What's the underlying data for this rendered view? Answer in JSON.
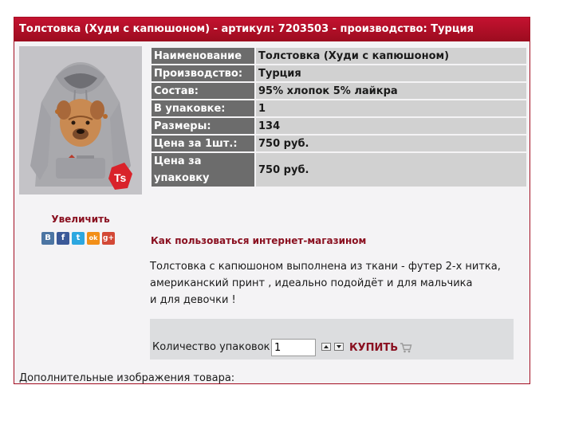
{
  "header": {
    "title": "Толстовка (Худи с капюшоном) - артикул: 7203503 - производство: Турция"
  },
  "product": {
    "image_alt": "Толстовка с принтом собаки шарпей",
    "zoom_label": "Увеличить",
    "social": [
      {
        "name": "vkontakte",
        "glyph": "B",
        "color": "#4c75a3"
      },
      {
        "name": "facebook",
        "glyph": "f",
        "color": "#3b5998"
      },
      {
        "name": "twitter",
        "glyph": "t",
        "color": "#2ca7e0"
      },
      {
        "name": "odnoklassniki",
        "glyph": "ok",
        "color": "#f28f18"
      },
      {
        "name": "google-plus",
        "glyph": "g+",
        "color": "#d34836"
      }
    ],
    "badge_logo_color": "#d9222a"
  },
  "specs": [
    {
      "key": "Наименование",
      "value": "Толстовка (Худи с капюшоном)"
    },
    {
      "key": "Производство:",
      "value": "Турция"
    },
    {
      "key": "Состав:",
      "value": "95% хлопок 5% лайкра"
    },
    {
      "key": "В упаковке:",
      "value": "1"
    },
    {
      "key": "Размеры:",
      "value": "134"
    },
    {
      "key": "Цена за 1шт.:",
      "value": "750 руб."
    },
    {
      "key": "Цена за упаковку",
      "value": "750 руб."
    }
  ],
  "howto_link": "Как пользоваться интернет-магазином",
  "description": {
    "line1": "Толстовка с капюшоном выполнена из ткани - футер 2-х нитка,",
    "line2": "американский принт , идеально подойдёт и для мальчика",
    "line3": "и для девочки !"
  },
  "buy": {
    "qty_label": "Количество упаковок:",
    "qty_value": "1",
    "buy_label": "КУПИТЬ"
  },
  "more_images_label": "Дополнительные изображения товара:",
  "colors": {
    "header_red": "#b0102a",
    "key_cell": "#6c6c6c",
    "value_cell": "#d1d1d1",
    "link_red": "#8a1020"
  }
}
